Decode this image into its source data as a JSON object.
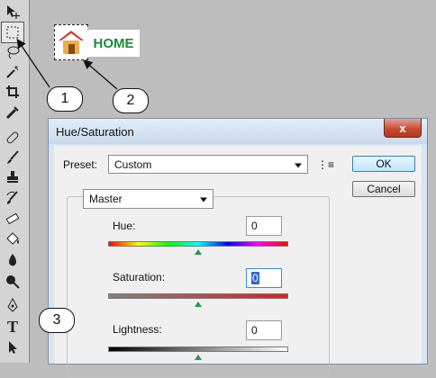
{
  "home": {
    "label": "HOME"
  },
  "callouts": {
    "one": "1",
    "two": "2",
    "three": "3"
  },
  "toolbox": {
    "tools": [
      "move-tool",
      "rectangular-marquee-tool",
      "lasso-tool",
      "magic-wand-tool",
      "crop-tool",
      "eyedropper-tool",
      "healing-brush-tool",
      "brush-tool",
      "clone-stamp-tool",
      "history-brush-tool",
      "eraser-tool",
      "paint-bucket-tool",
      "blur-tool",
      "dodge-tool",
      "pen-tool",
      "type-tool",
      "path-selection-tool"
    ],
    "type_glyph": "T"
  },
  "dialog": {
    "title": "Hue/Saturation",
    "close_label": "x",
    "preset_label": "Preset:",
    "preset_value": "Custom",
    "preset_menu_glyph": "⋮≡",
    "ok_label": "OK",
    "cancel_label": "Cancel",
    "channel_value": "Master",
    "hue_label": "Hue:",
    "hue_value": "0",
    "saturation_label": "Saturation:",
    "saturation_value": "0",
    "lightness_label": "Lightness:",
    "lightness_value": "0"
  },
  "colors": {
    "accent_green": "#1d8a3a",
    "slider_thumb": "#1f9a4a",
    "saturation_end": "#e01e1e"
  }
}
